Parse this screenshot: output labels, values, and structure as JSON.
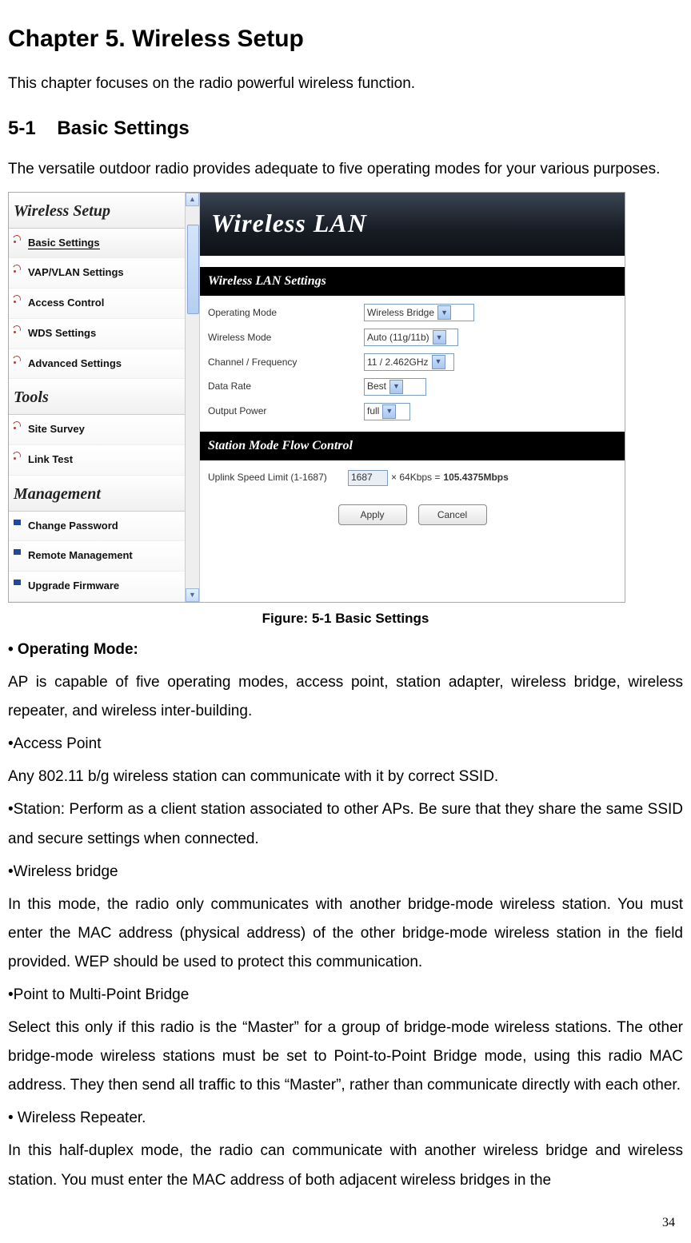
{
  "chapter_title": "Chapter 5.    Wireless Setup",
  "chapter_intro": "This chapter focuses on the radio powerful wireless function.",
  "section_number": "5-1",
  "section_title": "Basic Settings",
  "section_intro": "The versatile outdoor radio provides adequate to five operating modes for your various purposes.",
  "screenshot": {
    "sidebar": {
      "group1_title": "Wireless Setup",
      "group1_items": [
        "Basic Settings",
        "VAP/VLAN Settings",
        "Access Control",
        "WDS Settings",
        "Advanced Settings"
      ],
      "group2_title": "Tools",
      "group2_items": [
        "Site Survey",
        "Link Test"
      ],
      "group3_title": "Management",
      "group3_items": [
        "Change Password",
        "Remote Management",
        "Upgrade Firmware"
      ]
    },
    "main": {
      "banner": "Wireless LAN",
      "settings_hdr": "Wireless LAN Settings",
      "rows": {
        "op_mode_label": "Operating Mode",
        "op_mode_value": "Wireless Bridge",
        "wmode_label": "Wireless Mode",
        "wmode_value": "Auto (11g/11b)",
        "chan_label": "Channel / Frequency",
        "chan_value": "11 / 2.462GHz",
        "rate_label": "Data Rate",
        "rate_value": "Best",
        "power_label": "Output Power",
        "power_value": "full"
      },
      "flow_hdr": "Station Mode Flow Control",
      "flow": {
        "label": "Uplink Speed Limit (1-1687)",
        "value": "1687",
        "unit": "× 64Kbps  =",
        "result": "105.4375Mbps"
      },
      "buttons": {
        "apply": "Apply",
        "cancel": "Cancel"
      }
    }
  },
  "figure_caption": "Figure: 5-1 Basic Settings",
  "body": {
    "op_mode_head": "• Operating Mode:",
    "op_mode_text": "AP is capable of five operating modes, access point, station adapter, wireless bridge, wireless repeater, and wireless inter-building.",
    "ap_head": "•Access Point",
    "ap_text": "Any 802.11 b/g wireless station can communicate with it by correct SSID.",
    "station_text": "•Station: Perform as a client station associated to other APs. Be sure that they share the same SSID and secure settings when connected.",
    "wb_head": "•Wireless bridge",
    "wb_text": "In this mode, the radio only communicates with another bridge-mode wireless station. You must enter the MAC address (physical address) of the other bridge-mode wireless station in the field provided. WEP should be used to protect this communication.",
    "pmb_head": "•Point to Multi-Point Bridge",
    "pmb_text": "Select this only if this radio is the “Master” for a group of bridge-mode wireless stations. The other bridge-mode wireless stations must be set to Point-to-Point Bridge mode, using this radio MAC address. They then send all traffic to this “Master”, rather than communicate directly with each other.",
    "wr_head": "• Wireless Repeater.",
    "wr_text": "In this half-duplex mode, the radio can communicate with another wireless bridge and wireless station. You must enter the MAC address of both adjacent wireless bridges in the"
  },
  "page_number": "34"
}
